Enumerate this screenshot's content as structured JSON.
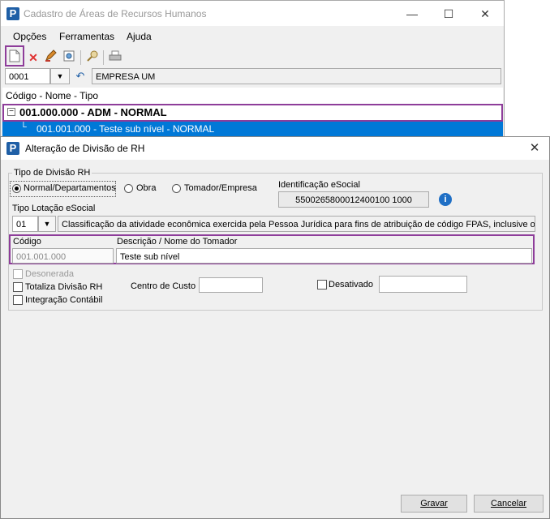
{
  "main_window": {
    "title": "Cadastro de Áreas de Recursos Humanos",
    "app_logo": "P",
    "menu": [
      "Opções",
      "Ferramentas",
      "Ajuda"
    ],
    "toolbar_icons": [
      "new-document-icon",
      "delete-icon",
      "edit-icon",
      "preview-icon",
      "search-icon",
      "print-icon"
    ],
    "company_code": "0001",
    "company_name": "EMPRESA UM",
    "tree_header": "Código - Nome - Tipo",
    "tree_root": "001.000.000 - ADM - NORMAL",
    "tree_root_toggle": "−",
    "tree_child": "001.001.000 - Teste sub nível - NORMAL",
    "tree_child_connector": "└",
    "selection_color": "#0078d7",
    "highlight_color": "#8e3d9a"
  },
  "dialog": {
    "title": "Alteração de Divisão de RH",
    "close_glyph": "✕",
    "group_label": "Tipo de Divisão RH",
    "radio_options": [
      "Normal/Departamentos",
      "Obra",
      "Tomador/Empresa"
    ],
    "selected_radio": "Normal/Departamentos",
    "identificacao_label": "Identificação eSocial",
    "identificacao_value": "5500265800012400100 1000",
    "info_icon_glyph": "i",
    "tipo_lotacao_label": "Tipo Lotação eSocial",
    "tipo_lotacao_code": "01",
    "tipo_lotacao_desc": "Classificação da atividade econômica exercida pela Pessoa Jurídica para fins de atribuição de código FPAS, inclusive obras",
    "codigo_label": "Código",
    "codigo_value": "001.001.000",
    "descricao_label": "Descrição / Nome do Tomador",
    "descricao_value": "Teste sub nível",
    "desonerada_label": "Desonerada",
    "totaliza_label": "Totaliza Divisão RH",
    "integracao_label": "Integração Contábil",
    "centro_custo_label": "Centro de Custo",
    "centro_custo_value": "",
    "desativado_label": "Desativado",
    "desativado_value": "",
    "gravar_label": "Gravar",
    "cancelar_label": "Cancelar"
  }
}
